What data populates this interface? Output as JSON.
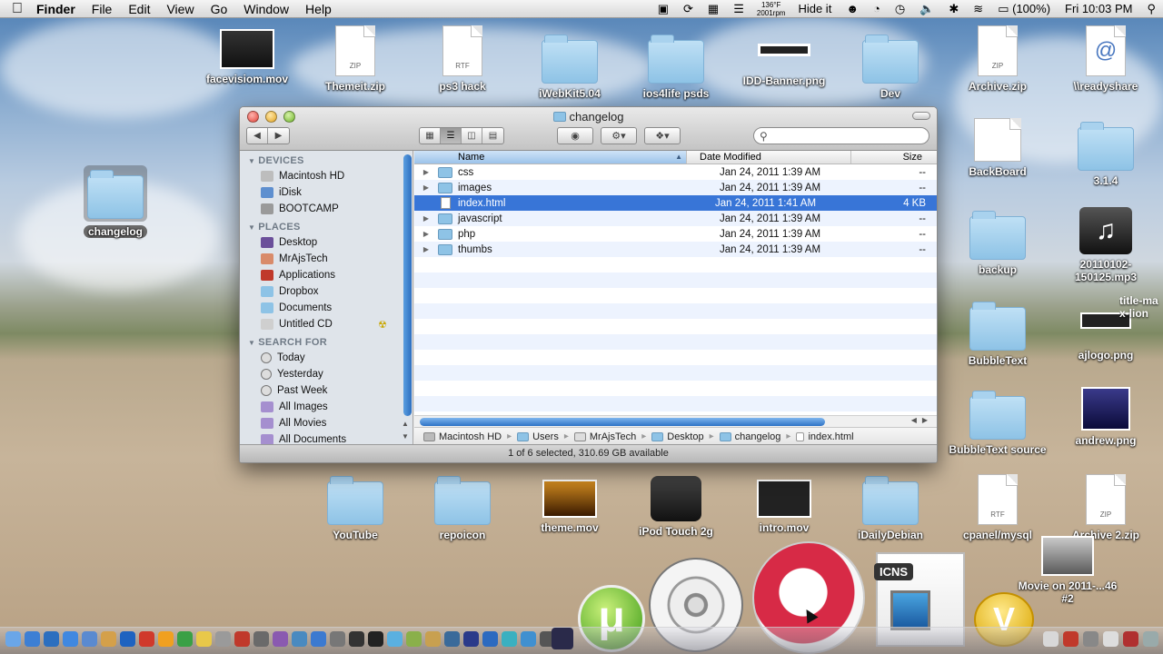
{
  "menubar": {
    "app": "Finder",
    "menus": [
      "File",
      "Edit",
      "View",
      "Go",
      "Window",
      "Help"
    ],
    "temp_line1": "136°F",
    "temp_line2": "2001rpm",
    "hide_it": "Hide it",
    "battery": "(100%)",
    "clock": "Fri 10:03 PM"
  },
  "desktop": {
    "top_icons": [
      "facevisiom.mov",
      "Themeit.zip",
      "ps3 hack",
      "iWebKit5.04",
      "ios4life psds",
      "IDD-Banner.png",
      "Dev",
      "Archive.zip",
      "\\\\readyshare"
    ],
    "left_icon": "changelog",
    "right_icons": [
      "BackBoard",
      "3.1.4",
      "backup",
      "20110102-150125.mp3",
      "BubbleText",
      "ajlogo.png",
      "BubbleText source",
      "andrew.png"
    ],
    "bottom_icons": [
      "YouTube",
      "repoicon",
      "theme.mov",
      "iPod Touch 2g",
      "intro.mov",
      "iDailyDebian",
      "cpanel/mysql",
      "Archive 2.zip"
    ],
    "movie_label": "Movie on 2011-...46 #2",
    "title_fragment": "title-ma\nx-lion",
    "zip_badge": "ZIP",
    "rtf_badge": "RTF",
    "icns_badge": "ICNS",
    "at_symbol": "@"
  },
  "finder": {
    "title": "changelog",
    "search_placeholder": "",
    "sidebar": {
      "devices_header": "DEVICES",
      "devices": [
        "Macintosh HD",
        "iDisk",
        "BOOTCAMP"
      ],
      "places_header": "PLACES",
      "places": [
        "Desktop",
        "MrAjsTech",
        "Applications",
        "Dropbox",
        "Documents",
        "Untitled CD"
      ],
      "search_header": "SEARCH FOR",
      "searches": [
        "Today",
        "Yesterday",
        "Past Week",
        "All Images",
        "All Movies",
        "All Documents"
      ]
    },
    "columns": {
      "name": "Name",
      "date": "Date Modified",
      "size": "Size"
    },
    "rows": [
      {
        "name": "css",
        "date": "Jan 24, 2011 1:39 AM",
        "size": "--"
      },
      {
        "name": "images",
        "date": "Jan 24, 2011 1:39 AM",
        "size": "--"
      },
      {
        "name": "index.html",
        "date": "Jan 24, 2011 1:41 AM",
        "size": "4 KB"
      },
      {
        "name": "javascript",
        "date": "Jan 24, 2011 1:39 AM",
        "size": "--"
      },
      {
        "name": "php",
        "date": "Jan 24, 2011 1:39 AM",
        "size": "--"
      },
      {
        "name": "thumbs",
        "date": "Jan 24, 2011 1:39 AM",
        "size": "--"
      }
    ],
    "path": [
      "Macintosh HD",
      "Users",
      "MrAjsTech",
      "Desktop",
      "changelog",
      "index.html"
    ],
    "status": "1 of 6 selected, 310.69 GB available"
  },
  "colors": {
    "selection": "#3875d7",
    "sidebar_bg": "#dfe4ea",
    "row_stripe": "#edf3fe"
  }
}
